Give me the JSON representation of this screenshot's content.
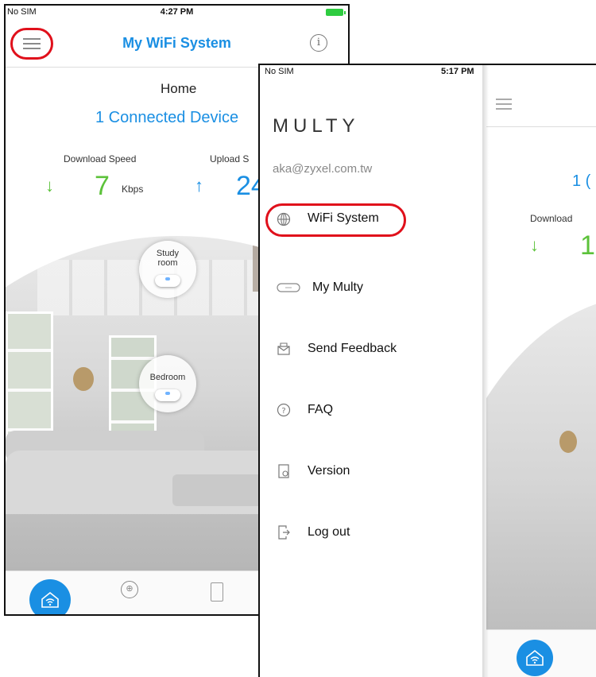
{
  "left_screen": {
    "status": {
      "carrier": "No SIM",
      "time": "4:27 PM"
    },
    "nav": {
      "title": "My WiFi System"
    },
    "home": {
      "location": "Home",
      "connected": "1 Connected Device",
      "download_label": "Download Speed",
      "download_value": "7",
      "download_unit": "Kbps",
      "upload_label": "Upload S",
      "upload_value": "24"
    },
    "nodes": [
      {
        "label": "Study room"
      },
      {
        "label": "Bedroom"
      }
    ]
  },
  "right_screen": {
    "status": {
      "carrier": "No SIM",
      "time": "5:17 PM"
    },
    "drawer": {
      "brand": "MULTY",
      "email": "aka@zyxel.com.tw",
      "items": [
        {
          "label": "WiFi System",
          "icon": "globe-icon"
        },
        {
          "label": "My Multy",
          "icon": "multy-device-icon"
        },
        {
          "label": "Send Feedback",
          "icon": "feedback-icon"
        },
        {
          "label": "FAQ",
          "icon": "question-icon"
        },
        {
          "label": "Version",
          "icon": "version-icon"
        },
        {
          "label": "Log out",
          "icon": "logout-icon"
        }
      ]
    },
    "background": {
      "connected_partial": "1 (",
      "download_label_partial": "Download",
      "download_value_partial": "1"
    }
  },
  "colors": {
    "accent": "#1a8fe3",
    "download": "#5cc23a",
    "highlight": "#e0101b"
  }
}
